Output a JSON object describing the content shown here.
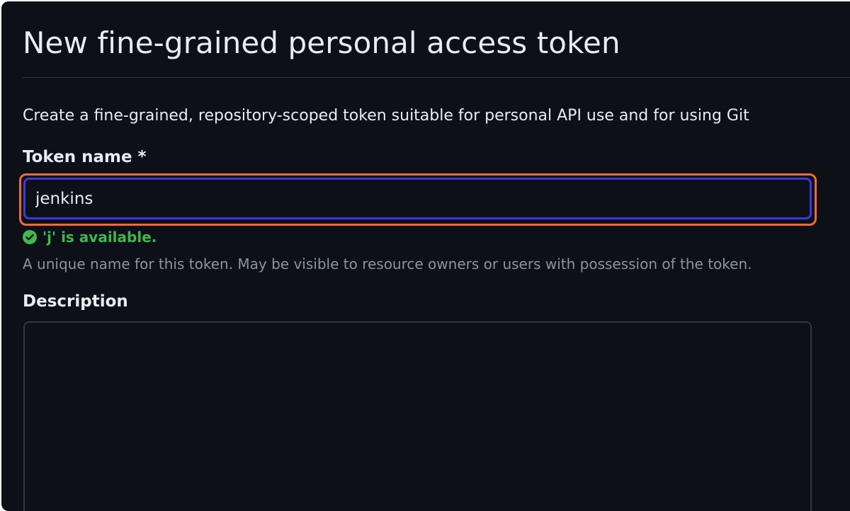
{
  "header": {
    "title": "New fine-grained personal access token"
  },
  "intro": {
    "text": "Create a fine-grained, repository-scoped token suitable for personal API use and for using Git"
  },
  "token_name": {
    "label": "Token name *",
    "value": "jenkins",
    "availability": "'j' is available.",
    "hint": "A unique name for this token. May be visible to resource owners or users with possession of the token."
  },
  "description": {
    "label": "Description",
    "value": ""
  },
  "icons": {
    "availability": "check-circle-icon"
  },
  "colors": {
    "background": "#0d1117",
    "text": "#e6edf3",
    "muted": "#8b949e",
    "success": "#3fb950",
    "focus_border": "#3b38e0",
    "highlight": "#f06a3a",
    "border": "#30363d"
  }
}
